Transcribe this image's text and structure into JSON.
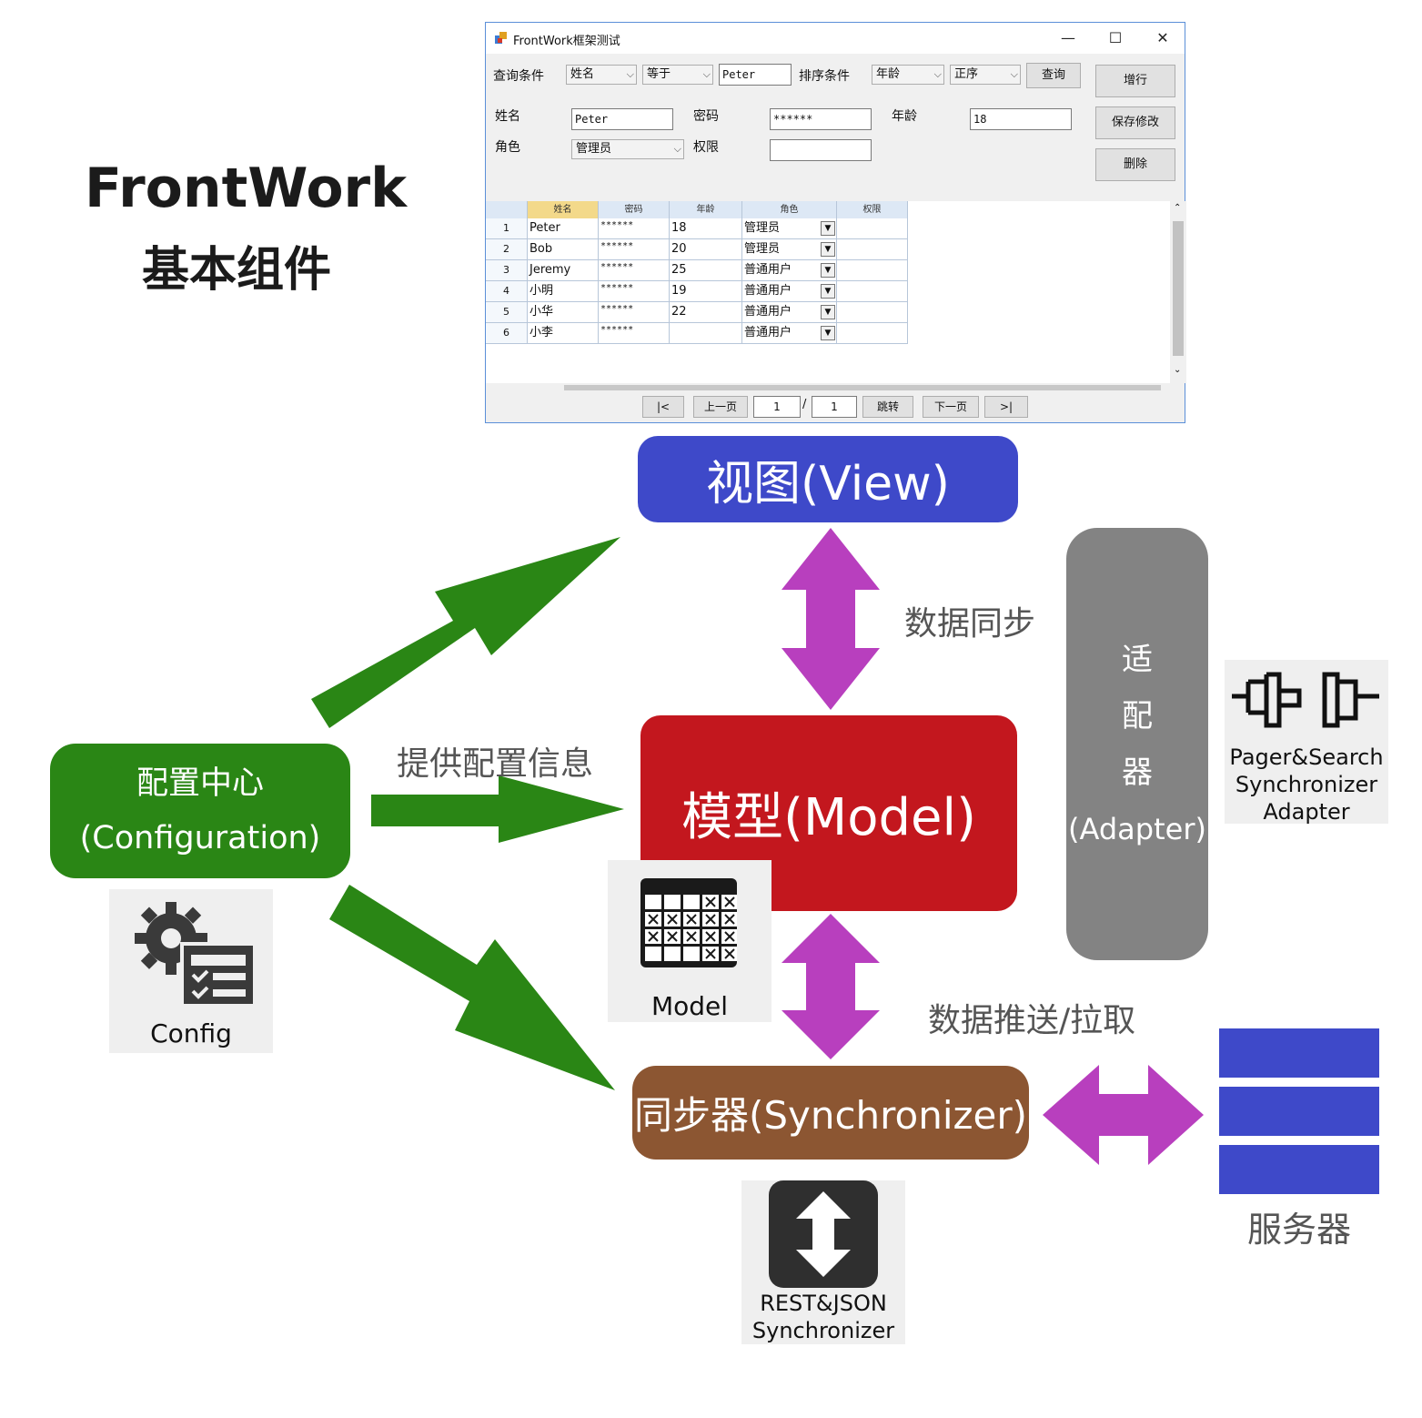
{
  "title": {
    "line1": "FrontWork",
    "line2": "基本组件"
  },
  "window": {
    "title": "FrontWork框架测试",
    "controls": {
      "minimize": "—",
      "maximize": "☐",
      "close": "✕"
    },
    "query": {
      "label": "查询条件",
      "field": "姓名",
      "operator": "等于",
      "value": "Peter",
      "sort_label": "排序条件",
      "sort_field": "年龄",
      "sort_order": "正序",
      "search_button": "查询"
    },
    "form": {
      "name_label": "姓名",
      "name_value": "Peter",
      "password_label": "密码",
      "password_value": "******",
      "age_label": "年龄",
      "age_value": "18",
      "role_label": "角色",
      "role_value": "管理员",
      "permission_label": "权限",
      "permission_value": ""
    },
    "buttons": {
      "add": "增行",
      "save": "保存修改",
      "delete": "删除"
    },
    "grid": {
      "headers": [
        "姓名",
        "密码",
        "年龄",
        "角色",
        "权限"
      ],
      "rows": [
        {
          "no": "1",
          "name": "Peter",
          "password": "******",
          "age": "18",
          "role": "管理员",
          "permission": ""
        },
        {
          "no": "2",
          "name": "Bob",
          "password": "******",
          "age": "20",
          "role": "管理员",
          "permission": ""
        },
        {
          "no": "3",
          "name": "Jeremy",
          "password": "******",
          "age": "25",
          "role": "普通用户",
          "permission": ""
        },
        {
          "no": "4",
          "name": "小明",
          "password": "******",
          "age": "19",
          "role": "普通用户",
          "permission": ""
        },
        {
          "no": "5",
          "name": "小华",
          "password": "******",
          "age": "22",
          "role": "普通用户",
          "permission": ""
        },
        {
          "no": "6",
          "name": "小李",
          "password": "******",
          "age": "",
          "role": "普通用户",
          "permission": ""
        }
      ]
    },
    "pager": {
      "first": "|<",
      "prev": "上一页",
      "current": "1",
      "separator": "/",
      "total": "1",
      "jump": "跳转",
      "next": "下一页",
      "last": ">|"
    }
  },
  "diagram": {
    "view": "视图(View)",
    "model": "模型(Model)",
    "config_line1": "配置中心",
    "config_line2": "(Configuration)",
    "synchronizer": "同步器(Synchronizer)",
    "adapter_chars": [
      "适",
      "配",
      "器"
    ],
    "adapter_en": "(Adapter)",
    "label_data_sync": "数据同步",
    "label_provide_config": "提供配置信息",
    "label_push_pull": "数据推送/拉取",
    "server": "服务器",
    "tile_config": "Config",
    "tile_model": "Model",
    "tile_adapter": [
      "Pager&Search",
      "Synchronizer",
      "Adapter"
    ],
    "tile_sync": [
      "REST&JSON",
      "Synchronizer"
    ]
  },
  "colors": {
    "view": "#3e49c9",
    "model": "#c3171e",
    "config": "#2a8615",
    "synchronizer": "#8c5632",
    "adapter": "#838383",
    "green_arrow": "#2a8615",
    "purple_arrow": "#b83fbe",
    "server": "#3e49c9"
  }
}
